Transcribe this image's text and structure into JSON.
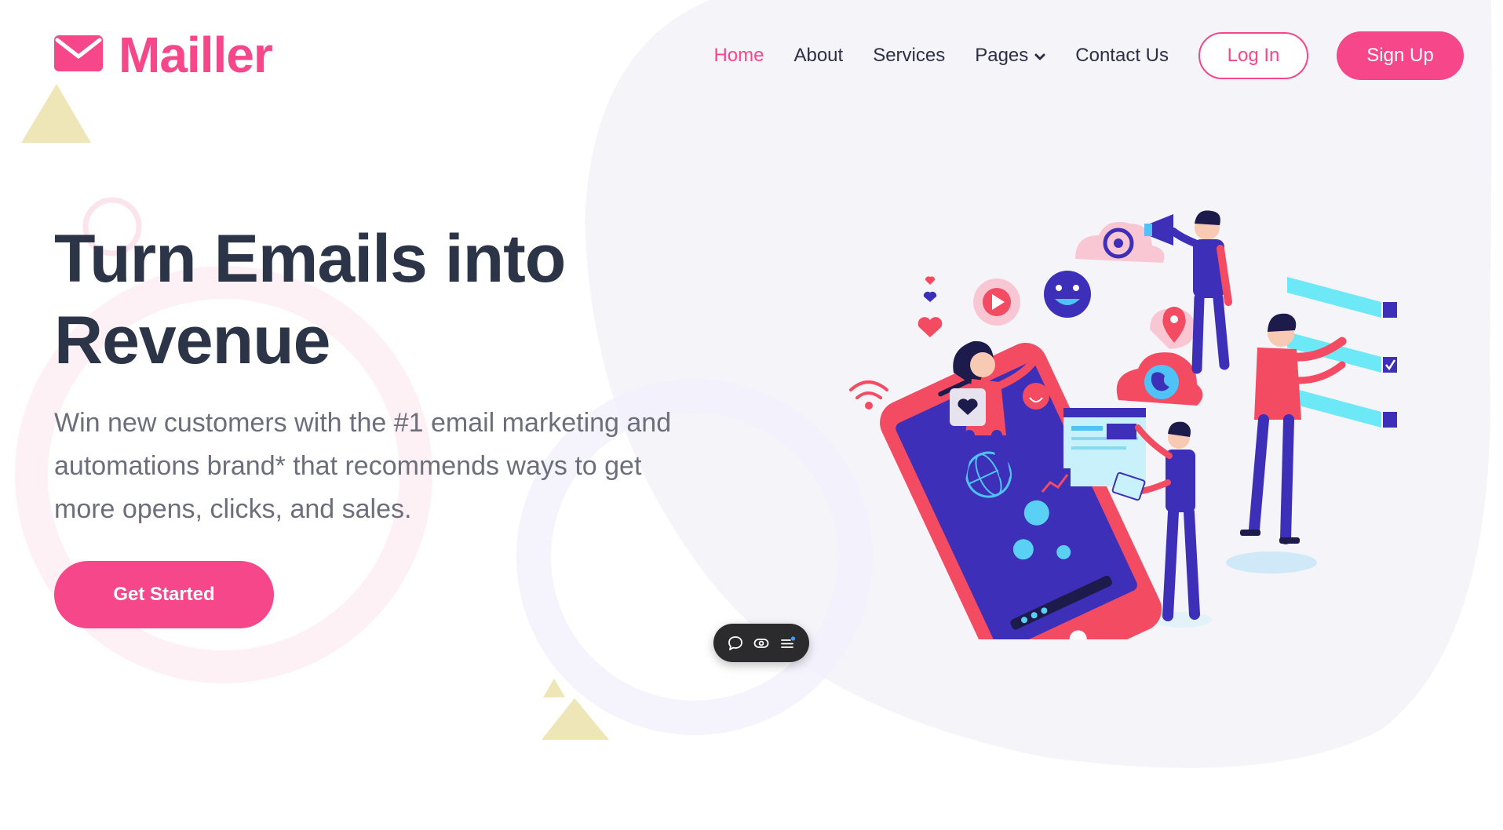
{
  "brand": {
    "name": "Mailler",
    "icon": "envelope-icon",
    "color": "#f5478a"
  },
  "nav": {
    "items": [
      {
        "label": "Home",
        "active": true
      },
      {
        "label": "About",
        "active": false
      },
      {
        "label": "Services",
        "active": false
      },
      {
        "label": "Pages",
        "active": false,
        "has_dropdown": true
      },
      {
        "label": "Contact Us",
        "active": false
      }
    ],
    "login_label": "Log In",
    "signup_label": "Sign Up"
  },
  "hero": {
    "title_line1": "Turn Emails into",
    "title_line2": "Revenue",
    "description_line1": "Win new customers with the #1 email marketing and",
    "description_line2": "automations brand* that recommends ways to get",
    "description_line3": "more opens, clicks, and sales.",
    "cta_label": "Get Started"
  },
  "toolbar": {
    "icons": [
      "comment-icon",
      "eye-icon",
      "menu-icon"
    ]
  },
  "colors": {
    "accent": "#f5478a",
    "heading": "#2c3447",
    "body_text": "#6c6f7b",
    "blob": "#f5f4f9",
    "triangle": "#efe6b8"
  }
}
